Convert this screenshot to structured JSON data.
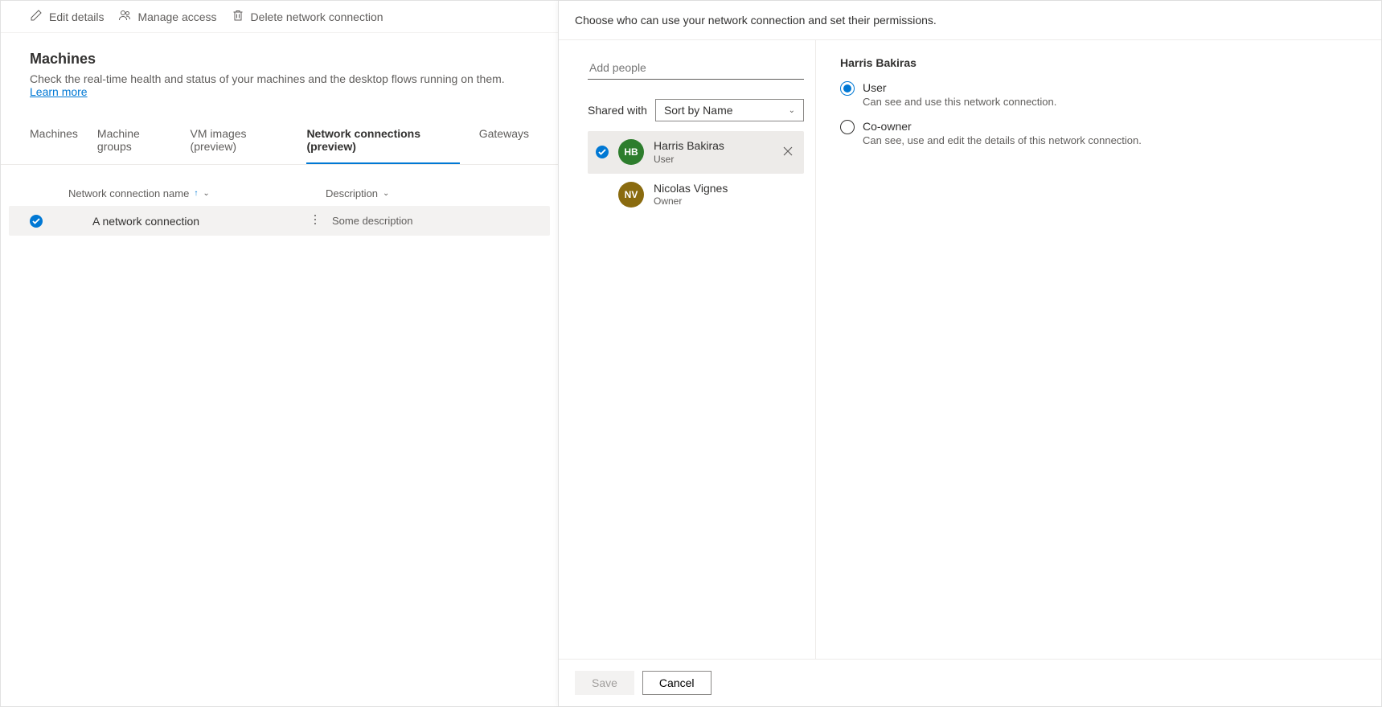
{
  "cmdbar": {
    "edit": "Edit details",
    "manage": "Manage access",
    "delete": "Delete network connection"
  },
  "page": {
    "title": "Machines",
    "subtitle_text": "Check the real-time health and status of your machines and the desktop flows running on them. ",
    "learn_more": "Learn more"
  },
  "tabs": {
    "machines": "Machines",
    "groups": "Machine groups",
    "vm": "VM images (preview)",
    "net": "Network connections (preview)",
    "gateways": "Gateways"
  },
  "columns": {
    "name": "Network connection name",
    "desc": "Description"
  },
  "row": {
    "name": "A network connection",
    "desc": "Some description"
  },
  "panel": {
    "header": "Choose who can use your network connection and set their permissions.",
    "add_placeholder": "Add people",
    "shared_with": "Shared with",
    "sort": "Sort by Name",
    "people": [
      {
        "name": "Harris Bakiras",
        "role": "User",
        "initials": "HB",
        "color": "#2d7d2d",
        "selected": true,
        "removable": true
      },
      {
        "name": "Nicolas Vignes",
        "role": "Owner",
        "initials": "NV",
        "color": "#8a6b0f",
        "selected": false,
        "removable": false
      }
    ],
    "perm_title": "Harris Bakiras",
    "perm_options": [
      {
        "label": "User",
        "desc": "Can see and use this network connection.",
        "checked": true
      },
      {
        "label": "Co-owner",
        "desc": "Can see, use and edit the details of this network connection.",
        "checked": false
      }
    ],
    "save": "Save",
    "cancel": "Cancel"
  }
}
